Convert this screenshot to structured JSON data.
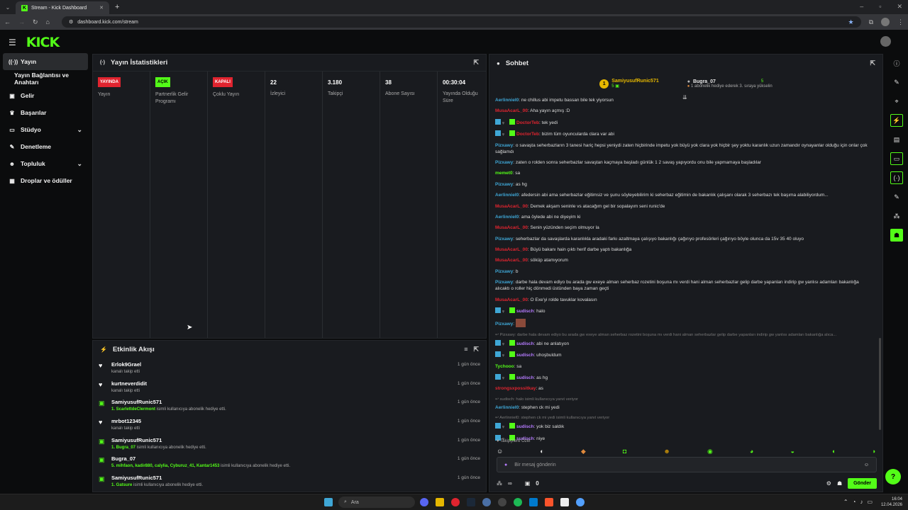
{
  "browser": {
    "tab_title": "Stream - Kick Dashboard",
    "url": "dashboard.kick.com/stream"
  },
  "header": {
    "logo": "KICK"
  },
  "sidebar": {
    "items": [
      {
        "label": "Yayın",
        "icon": "broadcast-icon"
      },
      {
        "label": "Yayın Bağlantısı ve Anahtarı"
      },
      {
        "label": "Gelir",
        "icon": "money-icon"
      },
      {
        "label": "Başarılar",
        "icon": "trophy-icon"
      },
      {
        "label": "Stüdyo",
        "icon": "tv-icon"
      },
      {
        "label": "Denetleme",
        "icon": "wrench-icon"
      },
      {
        "label": "Topluluk",
        "icon": "people-icon"
      },
      {
        "label": "Droplar ve ödüller",
        "icon": "gift-icon"
      }
    ]
  },
  "stats": {
    "title": "Yayın İstatistikleri",
    "cols": [
      {
        "badge": "YAYINDA",
        "label": "Yayın"
      },
      {
        "badge": "AÇIK",
        "label": "Partnerlik Gelir Programı"
      },
      {
        "badge": "KAPALI",
        "label": "Çoklu Yayın"
      },
      {
        "value": "22",
        "label": "İzleyici"
      },
      {
        "value": "3.180",
        "label": "Takipçi"
      },
      {
        "value": "38",
        "label": "Abone Sayısı"
      },
      {
        "value": "00:30:04",
        "label": "Yayında Olduğu Süre"
      }
    ]
  },
  "activity": {
    "title": "Etkinlik Akışı",
    "items": [
      {
        "user": "Erlok9Grael",
        "desc": "kanalı takip etti",
        "time": "1 gün önce",
        "type": "follow"
      },
      {
        "user": "kurtneverdidit",
        "desc": "kanalı takip etti",
        "time": "1 gün önce",
        "type": "follow"
      },
      {
        "user": "SamiyusufRunic571",
        "hl": "1. ScarlettdeClermont",
        "desc": " isimli kullanıcıya abonelik hediye etti.",
        "time": "1 gün önce",
        "type": "gift"
      },
      {
        "user": "mrbot12345",
        "desc": "kanalı takip etti",
        "time": "1 gün önce",
        "type": "follow"
      },
      {
        "user": "SamiyusufRunic571",
        "hl": "1. Bugra_07",
        "desc": " isimli kullanıcıya abonelik hediye etti.",
        "time": "1 gün önce",
        "type": "gift"
      },
      {
        "user": "Bugra_07",
        "hl": "5. mihfaon, kadir880, calylia, Cyburuz_41, Kantar1453",
        "desc": " isimli kullanıcıya abonelik hediye etti.",
        "time": "1 gün önce",
        "type": "gift"
      },
      {
        "user": "SamiyusufRunic571",
        "hl": "1. Gatsure",
        "desc": " isimli kullanıcıya abonelik hediye etti.",
        "time": "1 gün önce",
        "type": "gift"
      }
    ]
  },
  "chat": {
    "title": "Sohbet",
    "pinned": {
      "rank": "1",
      "user1": "SamiyusufRunic571",
      "count1": "5",
      "user2": "Bugra_07",
      "count2": "5",
      "note": "1 abonelik hediye ederek 3. sıraya yükselin"
    },
    "messages": [
      {
        "u": "Aerlinniel0",
        "c": "#3fa7d6",
        "t": ": ne chillus abi impetu bassan bile tek yiyorsun"
      },
      {
        "u": "MusaAcarL_00",
        "c": "#e0242f",
        "t": ": Aha yayın açmış :D"
      },
      {
        "u": "DoctorTeb",
        "c": "#e0242f",
        "t": ": tek yedi",
        "icons": true
      },
      {
        "u": "DoctorTeb",
        "c": "#e0242f",
        "t": ": bizim tüm oyuncularda clara var abi",
        "icons": true
      },
      {
        "u": "Pizxawy",
        "c": "#3fa7d6",
        "t": ": o savaşta seherbazların 3 tanesi hariç hepsi yeniydi zaten hiçbirinde impetu yok büyü yok clara yok hiçbir şey yoktu karanlık uzun zamandır oynayanlar olduğu için onlar çok sağlamdı"
      },
      {
        "u": "Pizxawy",
        "c": "#3fa7d6",
        "t": ": zaten o rolden sonra seherbazlar savaştan kaçmaya başladı günlük 1 2 savaş yapıyordu onu bile yapmamaya başladılar"
      },
      {
        "u": "memet0",
        "c": "#53fc18",
        "t": ": sa"
      },
      {
        "u": "Pizxawy",
        "c": "#3fa7d6",
        "t": ": as hg"
      },
      {
        "u": "Aerlinniel0",
        "c": "#3fa7d6",
        "t": ": afedersin abi ama seherbazlar eğitimsiz ve şunu söyleyebilirim ki seherbaz eğitimin de bakanlık çalışanı olarak 3 seherbazı tek başıma alabiliyordum..."
      },
      {
        "u": "MusaAcarL_00",
        "c": "#e0242f",
        "t": ": Demek akşam seninle vs atacağım gel bir sopalayım seni runic'de"
      },
      {
        "u": "Aerlinniel0",
        "c": "#3fa7d6",
        "t": ": ama öylede abi ne diyeyim ki"
      },
      {
        "u": "MusaAcarL_00",
        "c": "#e0242f",
        "t": ": Senin yüzünden seçim olmuyor la"
      },
      {
        "u": "Pizxawy",
        "c": "#3fa7d6",
        "t": ": seherbazlar da savaşlarda karanlıkla aradaki farkı azaltmaya çalışıyo bakanlığı çağırıyo profesörleri çağırıyo böyle olunca da 15v 35 40 oluyo"
      },
      {
        "u": "MusaAcarL_00",
        "c": "#e0242f",
        "t": ": Büyü bakanı hain çıktı herif darbe yaptı bakanlığa"
      },
      {
        "u": "MusaAcarL_00",
        "c": "#e0242f",
        "t": ": söküp atamıyorum"
      },
      {
        "u": "Pizxawy",
        "c": "#3fa7d6",
        "t": ": b"
      },
      {
        "u": "Pizxawy",
        "c": "#3fa7d6",
        "t": ": darbe hala devam ediyo bu arada gw exeye alman seherbaz rozetini boşuna mı verdi hani alman seherbazlar gelip darbe yapanları indirip gw yanlısı adamları bakanlığa alıcaktı o roller hiç dönmedi üstünden baya zaman geçti"
      },
      {
        "u": "MusaAcarL_00",
        "c": "#e0242f",
        "t": ": O Exe'yi rolde tavuklar kovalasın"
      },
      {
        "u": "sudisch",
        "c": "#b57bff",
        "t": ": halo",
        "icons": true
      },
      {
        "u": "Pizxawy",
        "c": "#3fa7d6",
        "t": ":",
        "emote": true
      },
      {
        "reply": "Pizxawy: darbe hala devam ediyo bu arada gw exeye alman seherbaz rozetini boşuna mı verdi hani alman seherbazlar gelip darbe yapanları indirip gw yanlısı adamları bakanlığa alıca..."
      },
      {
        "u": "sudisch",
        "c": "#b57bff",
        "t": ": abi ne anlatıyon",
        "icons": true
      },
      {
        "u": "sudisch",
        "c": "#b57bff",
        "t": ": uhoşbuldum",
        "icons": true
      },
      {
        "u": "Tychooo",
        "c": "#53fc18",
        "t": ": sa"
      },
      {
        "u": "sudisch",
        "c": "#b57bff",
        "t": ": as hg",
        "icons": true
      },
      {
        "u": "strongsxpossitkay",
        "c": "#e0242f",
        "t": ": as"
      },
      {
        "reply": "sudisch: halo isimli kullanıcıya yanıt veriyor"
      },
      {
        "u": "Aerlinniel0",
        "c": "#3fa7d6",
        "t": ": stephen ck mi yedi"
      },
      {
        "reply": "Aerlinniel0: stephen ck mi yedi isimli kullanıcıya yanıt veriyor"
      },
      {
        "u": "sudisch",
        "c": "#b57bff",
        "t": ": yok biz saldık",
        "icons": true
      },
      {
        "u": "sudisch",
        "c": "#b57bff",
        "t": ": niye",
        "icons": true
      }
    ],
    "followers_only": "Takipçilere Özel",
    "input_placeholder": "Bir mesaj gönderin",
    "points": "∞",
    "count": "0",
    "send_label": "Gönder"
  },
  "taskbar": {
    "search_placeholder": "Ara",
    "time": "16:04",
    "date": "12.04.2026"
  },
  "colors": {
    "accent": "#53fc18",
    "panel": "#191b1f",
    "bg": "#0b0c0d"
  }
}
